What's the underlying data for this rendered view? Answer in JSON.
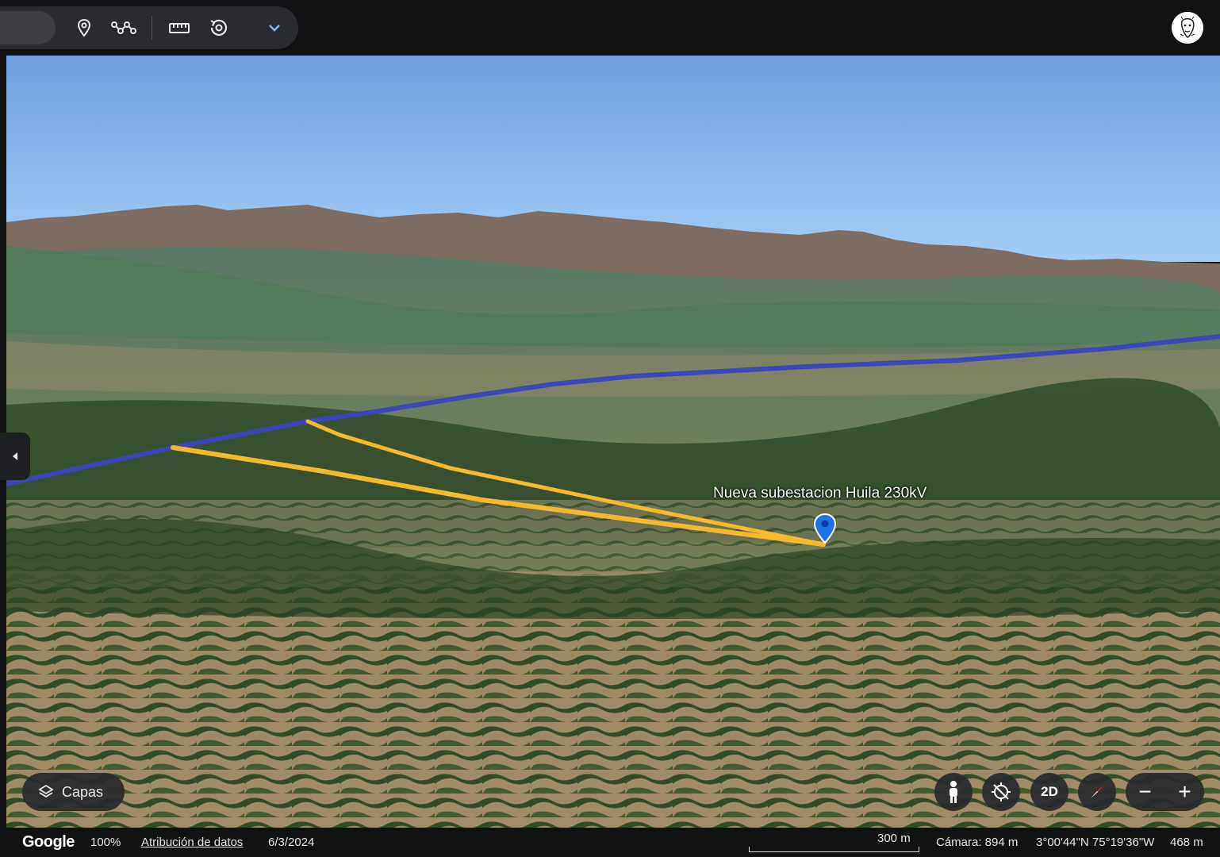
{
  "toolbar": {
    "tools": [
      {
        "name": "add-placemark",
        "icon": "pin-icon"
      },
      {
        "name": "add-path",
        "icon": "path-icon"
      },
      {
        "name": "measure",
        "icon": "ruler-icon"
      },
      {
        "name": "history",
        "icon": "history-icon"
      },
      {
        "name": "more",
        "icon": "chevron-down-icon"
      }
    ]
  },
  "map": {
    "placemark_label": "Nueva subestacion Huila 230kV",
    "colors": {
      "sky_top": "#6fa0e0",
      "sky_bottom": "#9cc8f5",
      "path_blue": "#3d46b8",
      "path_yellow": "#f4b92c",
      "pin": "#1a73e8"
    }
  },
  "controls": {
    "layers_label": "Capas",
    "mode_label": "2D",
    "zoom_out": "−",
    "zoom_in": "+"
  },
  "status": {
    "logo": "Google",
    "zoom": "100%",
    "attribution": "Atribución de datos",
    "date": "6/3/2024",
    "scale": "300 m",
    "camera": "Cámara: 894 m",
    "coordinates": "3°00'44\"N 75°19'36\"W",
    "elevation": "468 m"
  }
}
